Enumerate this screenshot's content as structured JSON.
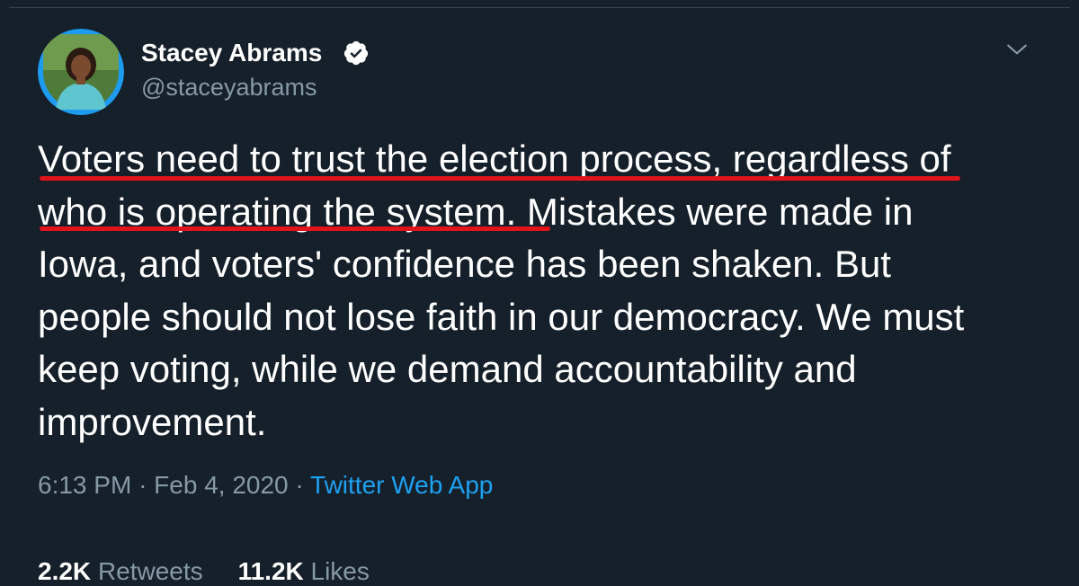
{
  "tweet": {
    "author_name": "Stacey Abrams",
    "handle": "@staceyabrams",
    "lines": [
      "Voters need to trust the election process, regardless of",
      "who is operating the system. Mistakes were made in",
      "Iowa, and voters' confidence has been shaken. But",
      "people should not lose faith in our democracy. We must",
      "keep voting, while we demand accountability and",
      "improvement."
    ],
    "time": "6:13 PM",
    "date": "Feb 4, 2020",
    "separator": "·",
    "source": "Twitter Web App",
    "retweets_count": "2.2K",
    "retweets_label": "Retweets",
    "likes_count": "11.2K",
    "likes_label": "Likes"
  },
  "icons": {
    "verified": "verified-badge-icon",
    "caret": "chevron-down-icon"
  },
  "colors": {
    "background": "#15202b",
    "text": "#ffffff",
    "secondary": "#8899a6",
    "link": "#1da1f2",
    "highlight_underline": "#e0141a"
  }
}
